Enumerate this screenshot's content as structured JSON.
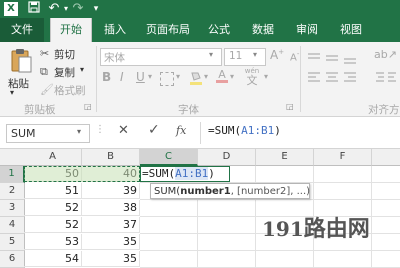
{
  "title_bar": {
    "qa_icons": [
      "excel-logo-icon",
      "save-icon",
      "undo-icon",
      "redo-icon",
      "customize-qa-icon"
    ]
  },
  "tabs": [
    "文件",
    "开始",
    "插入",
    "页面布局",
    "公式",
    "数据",
    "审阅",
    "视图"
  ],
  "ribbon": {
    "paste_label": "粘贴",
    "cut_label": "剪切",
    "copy_label": "复制",
    "format_painter_label": "格式刷",
    "clipboard_group": "剪贴板",
    "font_name": "宋体",
    "font_size": "11",
    "font_group": "字体",
    "wen_label": "wén",
    "wen_char": "文",
    "align_group": "对齐方"
  },
  "formula_bar": {
    "name_box": "SUM",
    "fx_label": "fx",
    "formula_prefix": "=SUM(",
    "formula_ref": "A1:B1",
    "formula_suffix": ")"
  },
  "columns": [
    "A",
    "B",
    "C",
    "D",
    "E",
    "F"
  ],
  "rows": [
    {
      "num": "1",
      "a": "50",
      "b": "40"
    },
    {
      "num": "2",
      "a": "51",
      "b": "39"
    },
    {
      "num": "3",
      "a": "52",
      "b": "38"
    },
    {
      "num": "4",
      "a": "52",
      "b": "37"
    },
    {
      "num": "5",
      "a": "53",
      "b": "35"
    },
    {
      "num": "6",
      "a": "54",
      "b": "35"
    }
  ],
  "cell_c1": {
    "prefix": "=SUM(",
    "ref": "A1:B1",
    "suffix": ")"
  },
  "tooltip": {
    "func": "SUM(",
    "arg1": "number1",
    "rest": ", [number2], ...)"
  },
  "watermark": {
    "num": "191",
    "text": "路由网"
  },
  "colors": {
    "excel_green": "#217346",
    "selection": "#217346",
    "ref_blue": "#4472c4"
  }
}
